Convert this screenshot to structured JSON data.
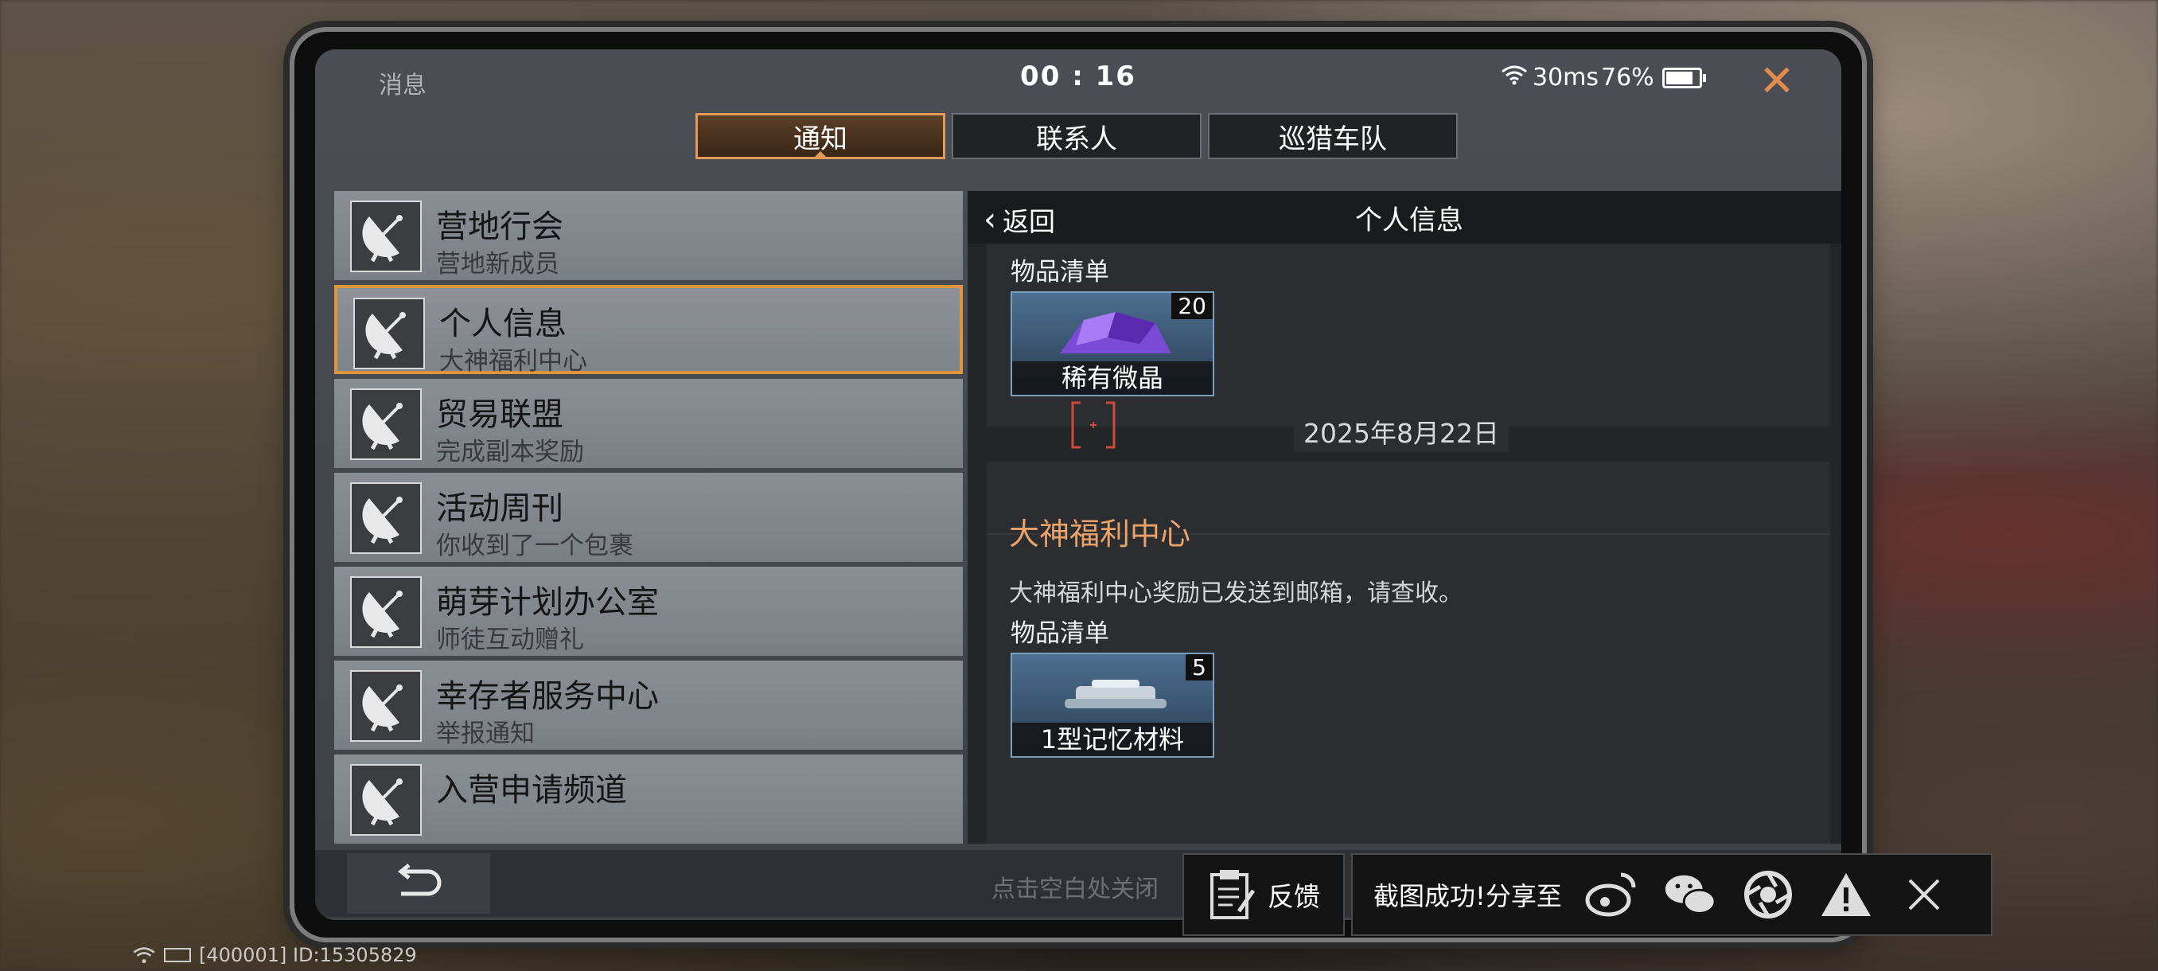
{
  "status": {
    "title": "消息",
    "time": "00 : 16",
    "ping": "30ms",
    "battery": "76%",
    "battery_level": 0.76
  },
  "tabs": [
    {
      "label": "通知",
      "active": true
    },
    {
      "label": "联系人",
      "active": false
    },
    {
      "label": "巡猎车队",
      "active": false
    }
  ],
  "list": [
    {
      "title": "营地行会",
      "sub": "营地新成员",
      "selected": false
    },
    {
      "title": "个人信息",
      "sub": "大神福利中心",
      "selected": true
    },
    {
      "title": "贸易联盟",
      "sub": "完成副本奖励",
      "selected": false
    },
    {
      "title": "活动周刊",
      "sub": "你收到了一个包裹",
      "selected": false
    },
    {
      "title": "萌芽计划办公室",
      "sub": "师徒互动赠礼",
      "selected": false
    },
    {
      "title": "幸存者服务中心",
      "sub": "举报通知",
      "selected": false
    },
    {
      "title": "入营申请频道",
      "sub": "",
      "selected": false
    }
  ],
  "detail": {
    "back_label": "返回",
    "title": "个人信息",
    "first_items_label": "物品清单",
    "first_item": {
      "name": "稀有微晶",
      "count": "20"
    },
    "date": "2025年8月22日",
    "sender": "大神福利中心",
    "body": "大神福利中心奖励已发送到邮箱，请查收。",
    "second_items_label": "物品清单",
    "second_item": {
      "name": "1型记忆材料",
      "count": "5"
    }
  },
  "bottom": {
    "hint": "点击空白处关闭"
  },
  "toast": {
    "feedback_label": "反馈",
    "share_label": "截图成功!分享至"
  },
  "footer": {
    "id_text": "[400001] ID:15305829"
  },
  "colors": {
    "accent": "#e39a56",
    "sender": "#eba36a",
    "close": "#e58b4a"
  }
}
